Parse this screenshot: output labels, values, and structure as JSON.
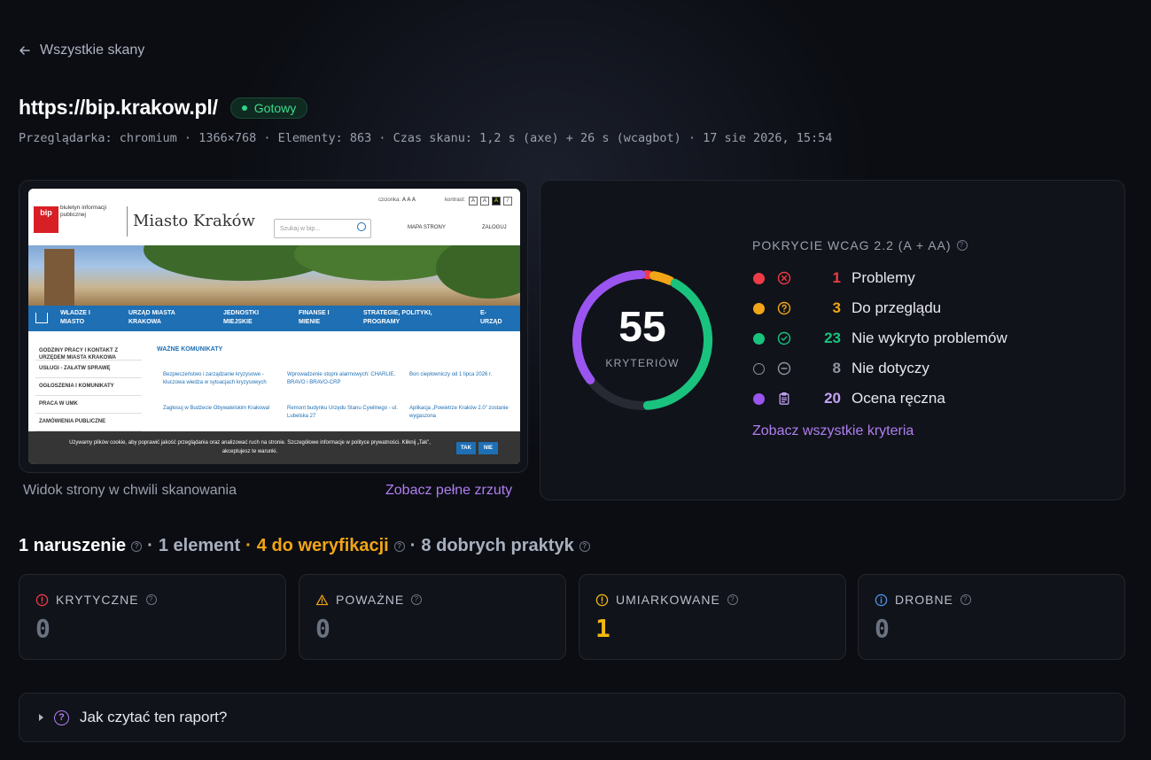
{
  "nav": {
    "back_label": "Wszystkie skany"
  },
  "scan": {
    "url": "https://bip.krakow.pl/",
    "status": "Gotowy",
    "meta": "Przeglądarka: chromium · 1366×768 · Elementy: 863 · Czas skanu: 1,2 s (axe) + 26 s (wcagbot) · 17 sie 2026, 15:54"
  },
  "screenshot": {
    "caption": "Widok strony w chwili skanowania",
    "link": "Zobacz pełne zrzuty",
    "site": {
      "bip_logo": "bip",
      "bip_sub": "biuletyn informacji publicznej",
      "city": "Miasto Kraków",
      "font_label": "czcionka:",
      "font_sizes": "A A A",
      "contrast_label": "kontrast:",
      "search_placeholder": "Szukaj w bip...",
      "map": "MAPA STRONY",
      "login": "ZALOGUJ",
      "nav": [
        "WŁADZE I MIASTO",
        "URZĄD MIASTA KRAKOWA",
        "JEDNOSTKI MIEJSKIE",
        "FINANSE I MIENIE",
        "STRATEGIE, POLITYKI, PROGRAMY",
        "E-URZĄD"
      ],
      "side": [
        "GODZINY PRACY I KONTAKT Z URZĘDEM MIASTA KRAKOWA",
        "USŁUGI - ZAŁATW SPRAWĘ",
        "OGŁOSZENIA I KOMUNIKATY",
        "PRACA W UMK",
        "ZAMÓWIENIA PUBLICZNE"
      ],
      "news_heading": "WAŻNE KOMUNIKATY",
      "news": [
        "Bezpieczeństwo i zarządzanie kryzysowe - kluczowa wiedza w sytuacjach kryzysowych",
        "Wprowadzenie stopni alarmowych: CHARLIE, BRAVO i BRAVO-CRP",
        "Bon ciepłowniczy od 1 lipca 2026 r.",
        "Zagłosuj w Budżecie Obywatelskim Krakowa!",
        "Remont budynku Urzędu Stanu Cywilnego - ul. Lubelska 27",
        "Aplikacja „Powietrze Kraków 2.0” zostanie wygaszona"
      ],
      "cookie": "Używamy plików cookie, aby poprawić jakość przeglądania oraz analizować ruch na stronie. Szczegółowe informacje w polityce prywatności. Kliknij „Tak”, akceptujesz te warunki.",
      "cookie_yes": "TAK",
      "cookie_no": "NIE"
    }
  },
  "coverage": {
    "title": "POKRYCIE WCAG 2.2 (A + AA)",
    "total": "55",
    "total_label": "KRYTERIÓW",
    "rows": [
      {
        "count": "1",
        "label": "Problemy",
        "color": "#ef3b45",
        "icon": "x-circle-icon"
      },
      {
        "count": "3",
        "label": "Do przeglądu",
        "color": "#f2a516",
        "icon": "question-circle-icon"
      },
      {
        "count": "23",
        "label": "Nie wykryto problemów",
        "color": "#19c37d",
        "icon": "check-circle-icon"
      },
      {
        "count": "8",
        "label": "Nie dotyczy",
        "color": "#8e94a1",
        "icon": "minus-circle-icon"
      },
      {
        "count": "20",
        "label": "Ocena ręczna",
        "color": "#9a55f0",
        "icon": "clipboard-icon"
      }
    ],
    "link": "Zobacz wszystkie kryteria"
  },
  "summary": {
    "violations": "1 naruszenie",
    "elements": "1 element",
    "to_verify": "4 do weryfikacji",
    "good": "8 dobrych praktyk",
    "separator": "·"
  },
  "severity": [
    {
      "label": "KRYTYCZNE",
      "value": "0",
      "color": "#ef3b45",
      "icon": "alert-circle-icon"
    },
    {
      "label": "POWAŻNE",
      "value": "0",
      "color": "#f2a516",
      "icon": "alert-triangle-icon"
    },
    {
      "label": "UMIARKOWANE",
      "value": "1",
      "color": "#f2b90f",
      "icon": "alert-circle-icon"
    },
    {
      "label": "DROBNE",
      "value": "0",
      "color": "#4f93e8",
      "icon": "info-circle-icon"
    }
  ],
  "howto": {
    "label": "Jak czytać ten raport?"
  }
}
